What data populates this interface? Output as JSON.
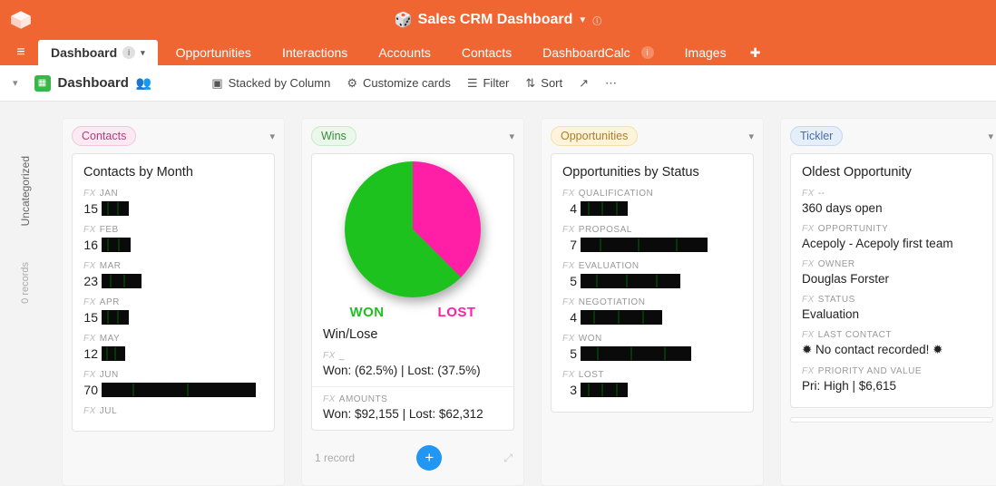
{
  "app": {
    "title": "Sales CRM Dashboard"
  },
  "tabs": [
    {
      "label": "Dashboard",
      "active": true
    },
    {
      "label": "Opportunities"
    },
    {
      "label": "Interactions"
    },
    {
      "label": "Accounts"
    },
    {
      "label": "Contacts"
    },
    {
      "label": "DashboardCalc"
    },
    {
      "label": "Images"
    }
  ],
  "toolbar": {
    "title": "Dashboard",
    "stacked": "Stacked by Column",
    "customize": "Customize cards",
    "filter": "Filter",
    "sort": "Sort"
  },
  "sidebar": {
    "uncategorized": "Uncategorized",
    "records": "0 records"
  },
  "columns": {
    "contacts": {
      "tag": "Contacts",
      "card_title": "Contacts by Month",
      "months": [
        {
          "label": "JAN",
          "value": "15",
          "bar": 30
        },
        {
          "label": "FEB",
          "value": "16",
          "bar": 32
        },
        {
          "label": "MAR",
          "value": "23",
          "bar": 44
        },
        {
          "label": "APR",
          "value": "15",
          "bar": 30
        },
        {
          "label": "MAY",
          "value": "12",
          "bar": 26
        },
        {
          "label": "JUN",
          "value": "70",
          "bar": 170
        },
        {
          "label": "JUL",
          "value": ""
        }
      ]
    },
    "wins": {
      "tag": "Wins",
      "card_title": "Win/Lose",
      "legend_won": "Won",
      "legend_lost": "Lost",
      "dash": "_",
      "line1": "Won: (62.5%) | Lost: (37.5%)",
      "amounts_label": "AMOUNTS",
      "amounts_line": "Won: $92,155 | Lost: $62,312",
      "records": "1 record"
    },
    "opps": {
      "tag": "Opportunities",
      "card_title": "Opportunities by Status",
      "stats": [
        {
          "label": "QUALIFICATION",
          "value": "4",
          "bar": 52
        },
        {
          "label": "PROPOSAL",
          "value": "7",
          "bar": 140
        },
        {
          "label": "EVALUATION",
          "value": "5",
          "bar": 110
        },
        {
          "label": "NEGOTIATION",
          "value": "4",
          "bar": 90
        },
        {
          "label": "WON",
          "value": "5",
          "bar": 122
        },
        {
          "label": "LOST",
          "value": "3",
          "bar": 52
        }
      ]
    },
    "tickler": {
      "tag": "Tickler",
      "card_title": "Oldest Opportunity",
      "fields": [
        {
          "label": "--",
          "value": "360 days open"
        },
        {
          "label": "OPPORTUNITY",
          "value": "Acepoly - Acepoly first team"
        },
        {
          "label": "OWNER",
          "value": "Douglas Forster"
        },
        {
          "label": "STATUS",
          "value": "Evaluation"
        },
        {
          "label": "LAST CONTACT",
          "value": "✹ No contact recorded! ✹"
        },
        {
          "label": "PRIORITY AND VALUE",
          "value": "Pri: High | $6,615"
        }
      ]
    }
  },
  "chart_data": {
    "type": "pie",
    "title": "Win/Lose",
    "series": [
      {
        "name": "Won",
        "value": 62.5,
        "color": "#1ec21e"
      },
      {
        "name": "Lost",
        "value": 37.5,
        "color": "#ff1fa6"
      }
    ]
  }
}
